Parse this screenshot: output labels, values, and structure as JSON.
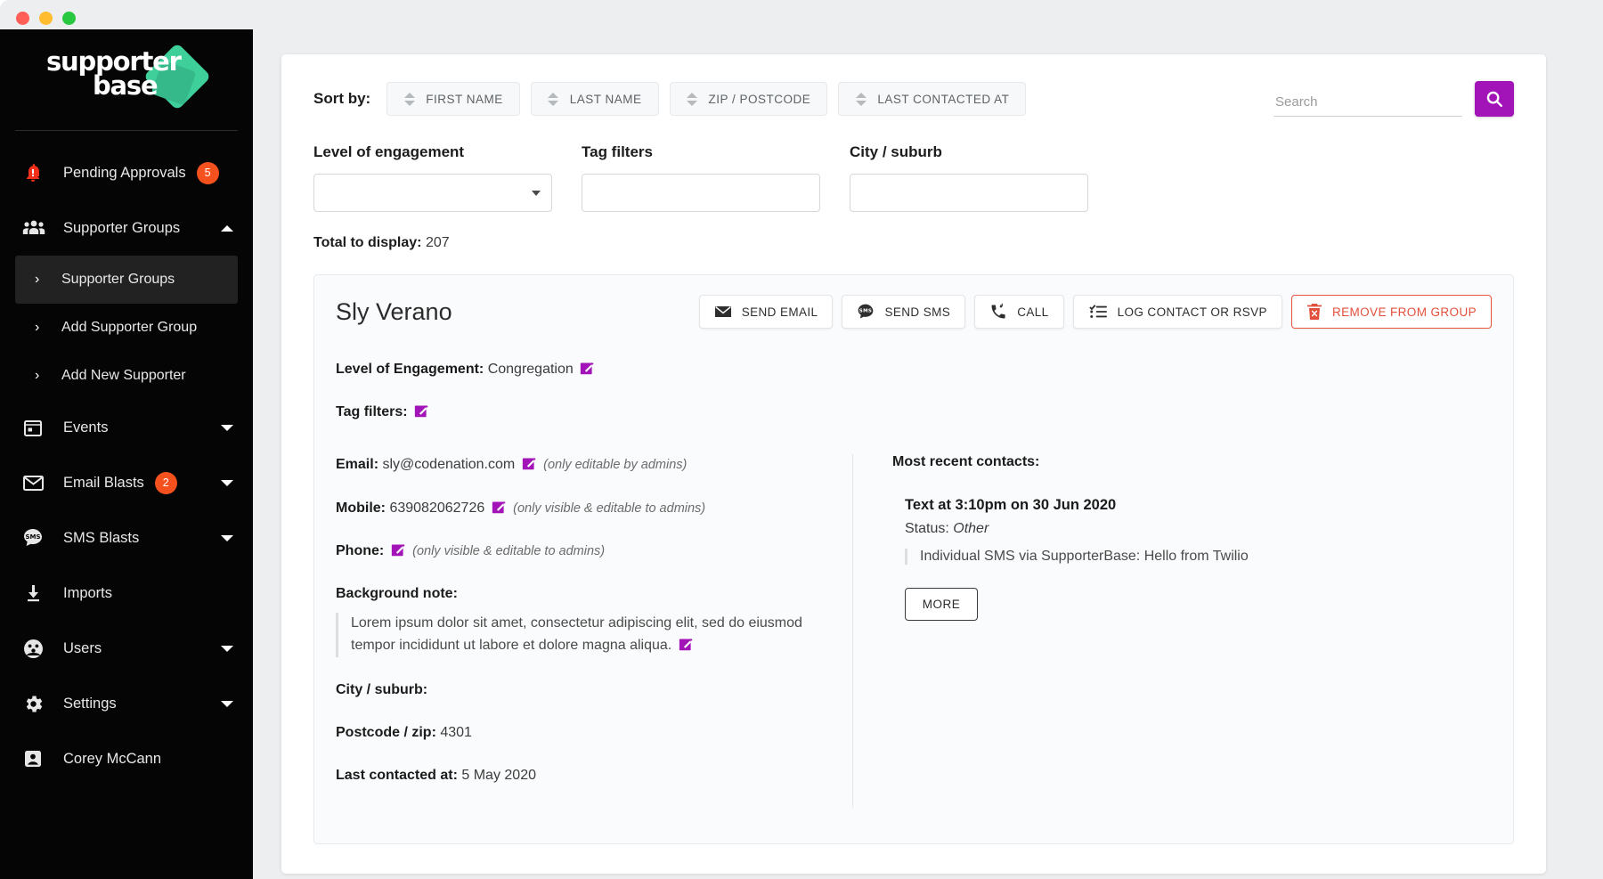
{
  "window": {
    "traffic_lights": [
      "close",
      "minimize",
      "maximize"
    ]
  },
  "sidebar": {
    "logo": {
      "line1": "supporter",
      "line2": "base"
    },
    "items": [
      {
        "label": "Pending Approvals",
        "icon": "bell-alert-icon",
        "badge": "5",
        "caret": null
      },
      {
        "label": "Supporter Groups",
        "icon": "people-group-icon",
        "badge": null,
        "caret": "up"
      },
      {
        "label": "Events",
        "icon": "calendar-icon",
        "badge": null,
        "caret": "down"
      },
      {
        "label": "Email Blasts",
        "icon": "envelope-icon",
        "badge": "2",
        "caret": "down"
      },
      {
        "label": "SMS Blasts",
        "icon": "sms-bubble-icon",
        "badge": null,
        "caret": "down"
      },
      {
        "label": "Imports",
        "icon": "download-icon",
        "badge": null,
        "caret": null
      },
      {
        "label": "Users",
        "icon": "users-circle-icon",
        "badge": null,
        "caret": "down"
      },
      {
        "label": "Settings",
        "icon": "gear-icon",
        "badge": null,
        "caret": "down"
      },
      {
        "label": "Corey McCann",
        "icon": "account-box-icon",
        "badge": null,
        "caret": null
      }
    ],
    "sub_items": [
      {
        "label": "Supporter Groups",
        "active": true
      },
      {
        "label": "Add Supporter Group",
        "active": false
      },
      {
        "label": "Add New Supporter",
        "active": false
      }
    ]
  },
  "toolbar": {
    "sort_label": "Sort by:",
    "sort_buttons": [
      "FIRST NAME",
      "LAST NAME",
      "ZIP / POSTCODE",
      "LAST CONTACTED AT"
    ],
    "search": {
      "placeholder": "Search",
      "value": "",
      "button_icon": "search-icon"
    }
  },
  "filters": [
    {
      "label": "Level of engagement",
      "type": "select",
      "value": ""
    },
    {
      "label": "Tag filters",
      "type": "text",
      "value": ""
    },
    {
      "label": "City / suburb",
      "type": "text",
      "value": ""
    }
  ],
  "total": {
    "label": "Total to display:",
    "value": "207"
  },
  "supporter": {
    "name": "Sly Verano",
    "actions": [
      {
        "label": "SEND EMAIL",
        "icon": "envelope-icon",
        "style": "default"
      },
      {
        "label": "SEND SMS",
        "icon": "sms-bubble-icon",
        "style": "default"
      },
      {
        "label": "CALL",
        "icon": "phone-icon",
        "style": "default"
      },
      {
        "label": "LOG CONTACT OR RSVP",
        "icon": "checklist-icon",
        "style": "default"
      },
      {
        "label": "REMOVE FROM GROUP",
        "icon": "trash-x-icon",
        "style": "danger"
      }
    ],
    "level_of_engagement": {
      "label": "Level of Engagement:",
      "value": "Congregation"
    },
    "tag_filters": {
      "label": "Tag filters:",
      "value": ""
    },
    "email": {
      "label": "Email:",
      "value": "sly@codenation.com",
      "note": "(only editable by admins)"
    },
    "mobile": {
      "label": "Mobile:",
      "value": "639082062726",
      "note": "(only visible & editable to admins)"
    },
    "phone": {
      "label": "Phone:",
      "value": "",
      "note": "(only visible & editable to admins)"
    },
    "background_note": {
      "label": "Background note:",
      "text": "Lorem ipsum dolor sit amet, consectetur adipiscing elit, sed do eiusmod tempor incididunt ut labore et dolore magna aliqua."
    },
    "city_suburb": {
      "label": "City / suburb:",
      "value": ""
    },
    "postcode": {
      "label": "Postcode / zip:",
      "value": "4301"
    },
    "last_contacted": {
      "label": "Last contacted at:",
      "value": "5 May 2020"
    }
  },
  "recent_contacts": {
    "title": "Most recent contacts:",
    "items": [
      {
        "when": "Text at 3:10pm on 30 Jun 2020",
        "status_label": "Status:",
        "status_value": "Other",
        "message": "Individual SMS via SupporterBase: Hello from Twilio"
      }
    ],
    "more_label": "MORE"
  },
  "colors": {
    "accent_purple": "#a214b8",
    "brand_green": "#3ecf9a",
    "badge_orange": "#f4511e",
    "danger_red": "#e2503c",
    "sidebar_bg": "#050505"
  }
}
